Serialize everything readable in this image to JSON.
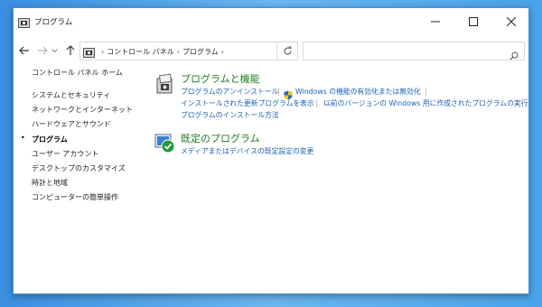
{
  "window": {
    "title": "プログラム"
  },
  "toolbar": {
    "breadcrumb": [
      "コントロール パネル",
      "プログラム"
    ],
    "search": {
      "value": "",
      "placeholder": ""
    }
  },
  "sidebar": {
    "home": "コントロール パネル ホーム",
    "items": [
      {
        "label": "システムとセキュリティ",
        "active": false
      },
      {
        "label": "ネットワークとインターネット",
        "active": false
      },
      {
        "label": "ハードウェアとサウンド",
        "active": false
      },
      {
        "label": "プログラム",
        "active": true
      },
      {
        "label": "ユーザー アカウント",
        "active": false
      },
      {
        "label": "デスクトップのカスタマイズ",
        "active": false
      },
      {
        "label": "時計と地域",
        "active": false
      },
      {
        "label": "コンピューターの簡単操作",
        "active": false
      }
    ]
  },
  "categories": [
    {
      "title": "プログラムと機能",
      "links": [
        "プログラムのアンインストール",
        "Windows の機能の有効化または無効化",
        "インストールされた更新プログラムを表示",
        "以前のバージョンの Windows 用に作成されたプログラムの実行",
        "プログラムのインストール方法"
      ]
    },
    {
      "title": "既定のプログラム",
      "links": [
        "メディアまたはデバイスの既定設定の変更"
      ]
    }
  ],
  "colors": {
    "accent_green": "#1e7c1e",
    "link_blue": "#1a5fb4",
    "desktop": "#4aa3ea"
  }
}
